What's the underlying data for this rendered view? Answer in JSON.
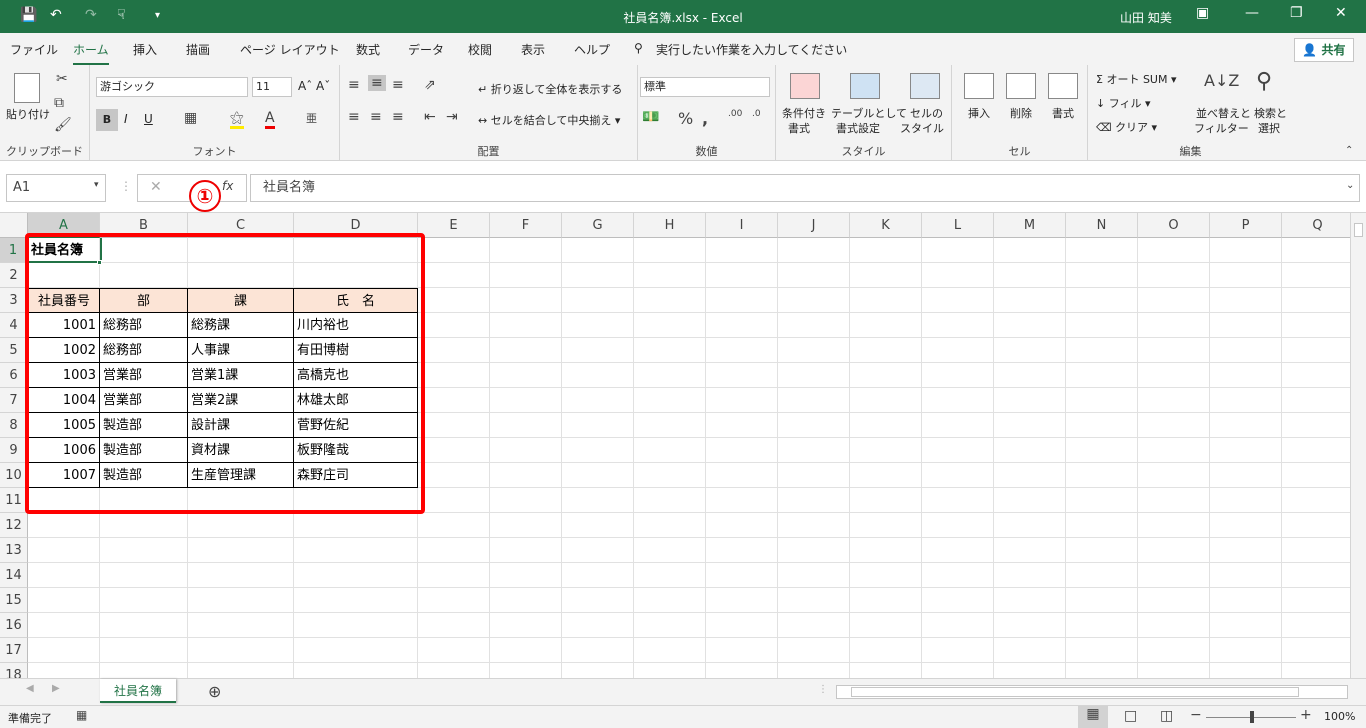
{
  "window": {
    "title": "社員名簿.xlsx  -  Excel",
    "user": "山田 知美"
  },
  "menu": {
    "tabs": [
      "ファイル",
      "ホーム",
      "挿入",
      "描画",
      "ページ レイアウト",
      "数式",
      "データ",
      "校閲",
      "表示",
      "ヘルプ"
    ],
    "active": "ホーム",
    "search": "実行したい作業を入力してください",
    "share": "共有"
  },
  "ribbon": {
    "clipboard": {
      "paste": "貼り付け",
      "label": "クリップボード"
    },
    "font": {
      "name": "游ゴシック",
      "size": "11",
      "label": "フォント"
    },
    "alignment": {
      "wrap": "折り返して全体を表示する",
      "merge": "セルを結合して中央揃え",
      "label": "配置"
    },
    "number": {
      "format": "標準",
      "label": "数値"
    },
    "styles": {
      "conditional_1": "条件付き",
      "conditional_2": "書式",
      "table_1": "テーブルとして",
      "table_2": "書式設定",
      "cell_1": "セルの",
      "cell_2": "スタイル",
      "label": "スタイル"
    },
    "cells": {
      "insert": "挿入",
      "delete": "削除",
      "format": "書式",
      "label": "セル"
    },
    "editing": {
      "autosum": "オート SUM",
      "fill": "フィル",
      "clear": "クリア",
      "sort_1": "並べ替えと",
      "sort_2": "フィルター",
      "find_1": "検索と",
      "find_2": "選択",
      "label": "編集"
    }
  },
  "formula_bar": {
    "name_box": "A1",
    "content": "社員名簿",
    "fx": "fx"
  },
  "annotation": {
    "badge": "①"
  },
  "sheet": {
    "columns": [
      "A",
      "B",
      "C",
      "D",
      "E",
      "F",
      "G",
      "H",
      "I",
      "J",
      "K",
      "L",
      "M",
      "N",
      "O",
      "P",
      "Q"
    ],
    "rows": [
      "1",
      "2",
      "3",
      "4",
      "5",
      "6",
      "7",
      "8",
      "9",
      "10",
      "11",
      "12",
      "13",
      "14",
      "15",
      "16",
      "17",
      "18"
    ],
    "title": "社員名簿",
    "headers": [
      "社員番号",
      "部",
      "課",
      "氏　名"
    ],
    "records": [
      [
        "1001",
        "総務部",
        "総務課",
        "川内裕也"
      ],
      [
        "1002",
        "総務部",
        "人事課",
        "有田博樹"
      ],
      [
        "1003",
        "営業部",
        "営業1課",
        "高橋克也"
      ],
      [
        "1004",
        "営業部",
        "営業2課",
        "林雄太郎"
      ],
      [
        "1005",
        "製造部",
        "設計課",
        "菅野佐紀"
      ],
      [
        "1006",
        "製造部",
        "資材課",
        "板野隆哉"
      ],
      [
        "1007",
        "製造部",
        "生産管理課",
        "森野庄司"
      ]
    ]
  },
  "tabs": {
    "sheet": "社員名簿"
  },
  "status": {
    "ready": "準備完了",
    "zoom": "100%"
  }
}
